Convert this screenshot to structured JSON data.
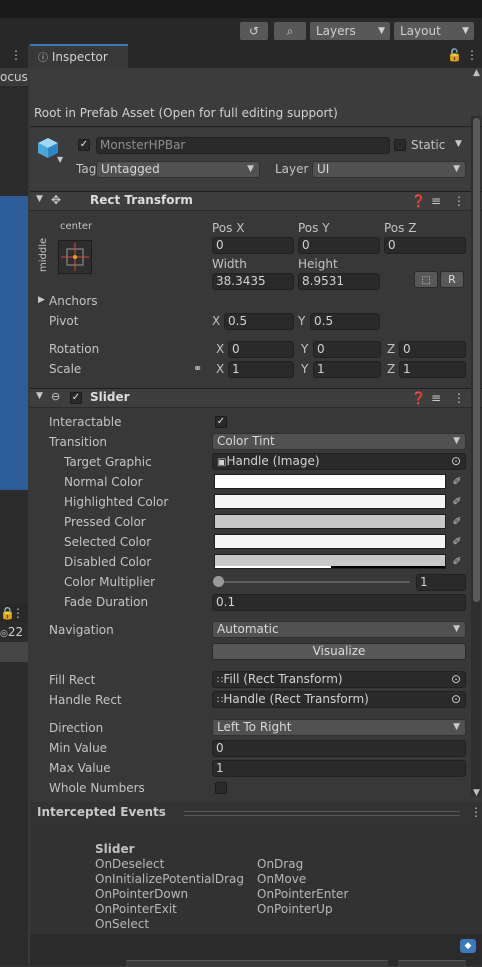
{
  "toolbar": {
    "history_icon": "history-icon",
    "search_icon": "search-icon",
    "layers_label": "Layers",
    "layout_label": "Layout"
  },
  "left_panel": {
    "partial_label": "ocus",
    "partial_count": "22"
  },
  "inspector": {
    "tab_label": "Inspector",
    "prefab_notice": "Root in Prefab Asset (Open for full editing support)",
    "object_name": "MonsterHPBar",
    "static_label": "Static",
    "tag_label": "Tag",
    "tag_value": "Untagged",
    "layer_label": "Layer",
    "layer_value": "UI"
  },
  "rect_transform": {
    "title": "Rect Transform",
    "anchor_h": "center",
    "anchor_v": "middle",
    "posx_label": "Pos X",
    "posx": "0",
    "posy_label": "Pos Y",
    "posy": "0",
    "posz_label": "Pos Z",
    "posz": "0",
    "width_label": "Width",
    "width": "38.3435",
    "height_label": "Height",
    "height": "8.9531",
    "r_label": "R",
    "anchors_label": "Anchors",
    "pivot_label": "Pivot",
    "pivot_x_label": "X",
    "pivot_x": "0.5",
    "pivot_y_label": "Y",
    "pivot_y": "0.5",
    "rotation_label": "Rotation",
    "rot_x": "0",
    "rot_y": "0",
    "rot_z": "0",
    "scale_label": "Scale",
    "scale_x": "1",
    "scale_y": "1",
    "scale_z": "1",
    "x_label": "X",
    "y_label": "Y",
    "z_label": "Z"
  },
  "slider": {
    "title": "Slider",
    "interactable_label": "Interactable",
    "transition_label": "Transition",
    "transition_value": "Color Tint",
    "target_graphic_label": "Target Graphic",
    "target_graphic_value": "Handle (Image)",
    "normal_color_label": "Normal Color",
    "highlighted_color_label": "Highlighted Color",
    "pressed_color_label": "Pressed Color",
    "selected_color_label": "Selected Color",
    "disabled_color_label": "Disabled Color",
    "colors": {
      "normal": "#ffffff",
      "highlighted": "#f5f5f5",
      "pressed": "#c8c8c8",
      "selected": "#f5f5f5",
      "disabled": "#c8c8c8"
    },
    "color_multiplier_label": "Color Multiplier",
    "color_multiplier_value": "1",
    "fade_duration_label": "Fade Duration",
    "fade_duration_value": "0.1",
    "navigation_label": "Navigation",
    "navigation_value": "Automatic",
    "visualize_label": "Visualize",
    "fill_rect_label": "Fill Rect",
    "fill_rect_value": "Fill (Rect Transform)",
    "handle_rect_label": "Handle Rect",
    "handle_rect_value": "Handle (Rect Transform)",
    "direction_label": "Direction",
    "direction_value": "Left To Right",
    "min_value_label": "Min Value",
    "min_value": "0",
    "max_value_label": "Max Value",
    "max_value": "1",
    "whole_numbers_label": "Whole Numbers"
  },
  "events": {
    "title": "Intercepted Events",
    "group": "Slider",
    "col1": [
      "OnDeselect",
      "OnInitializePotentialDrag",
      "OnPointerDown",
      "OnPointerExit",
      "OnSelect"
    ],
    "col2": [
      "OnDrag",
      "OnMove",
      "OnPointerEnter",
      "OnPointerUp"
    ]
  },
  "theme": {
    "accent": "#3a79bb",
    "panel_bg": "#383838",
    "field_bg": "#2a2a2a"
  }
}
